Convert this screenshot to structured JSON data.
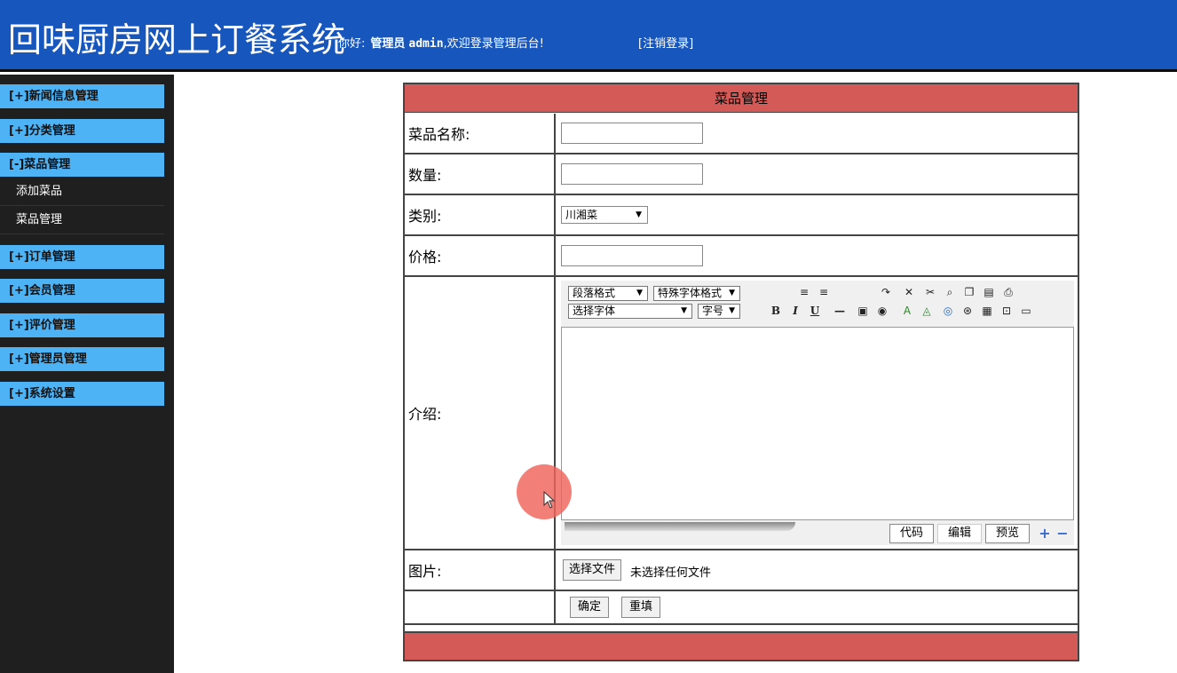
{
  "header": {
    "title": "回味厨房网上订餐系统",
    "greeting": "你好:",
    "role": "管理员",
    "username": "admin",
    "welcome": ",欢迎登录管理后台!",
    "logout_label": "[注销登录]"
  },
  "sidebar": {
    "groups": [
      {
        "label": "[+]新闻信息管理"
      },
      {
        "label": "[+]分类管理"
      },
      {
        "label": "[-]菜品管理"
      },
      {
        "label": "[+]订单管理"
      },
      {
        "label": "[+]会员管理"
      },
      {
        "label": "[+]评价管理"
      },
      {
        "label": "[+]管理员管理"
      },
      {
        "label": "[+]系统设置"
      }
    ],
    "dish_sub_items": [
      {
        "label": "添加菜品"
      },
      {
        "label": "菜品管理"
      }
    ]
  },
  "form": {
    "title": "菜品管理",
    "name_label": "菜品名称:",
    "name_value": "",
    "quantity_label": "数量:",
    "quantity_value": "",
    "category_label": "类别:",
    "category_value": "川湘菜",
    "price_label": "价格:",
    "price_value": "",
    "intro_label": "介绍:",
    "image_label": "图片:",
    "file_button": "选择文件",
    "file_status": "未选择任何文件",
    "submit_label": "确定",
    "reset_label": "重填"
  },
  "editor": {
    "paragraph_format": "段落格式",
    "special_format": "特殊字体格式",
    "font_family": "选择字体",
    "font_size": "字号",
    "modes": [
      "代码",
      "编辑",
      "预览"
    ],
    "content": ""
  },
  "colors": {
    "header_bg": "#1757bd",
    "sidebar_bg": "#1f1f1f",
    "menu_head_bg": "#4db3f5",
    "panel_bar": "#d35a57"
  }
}
